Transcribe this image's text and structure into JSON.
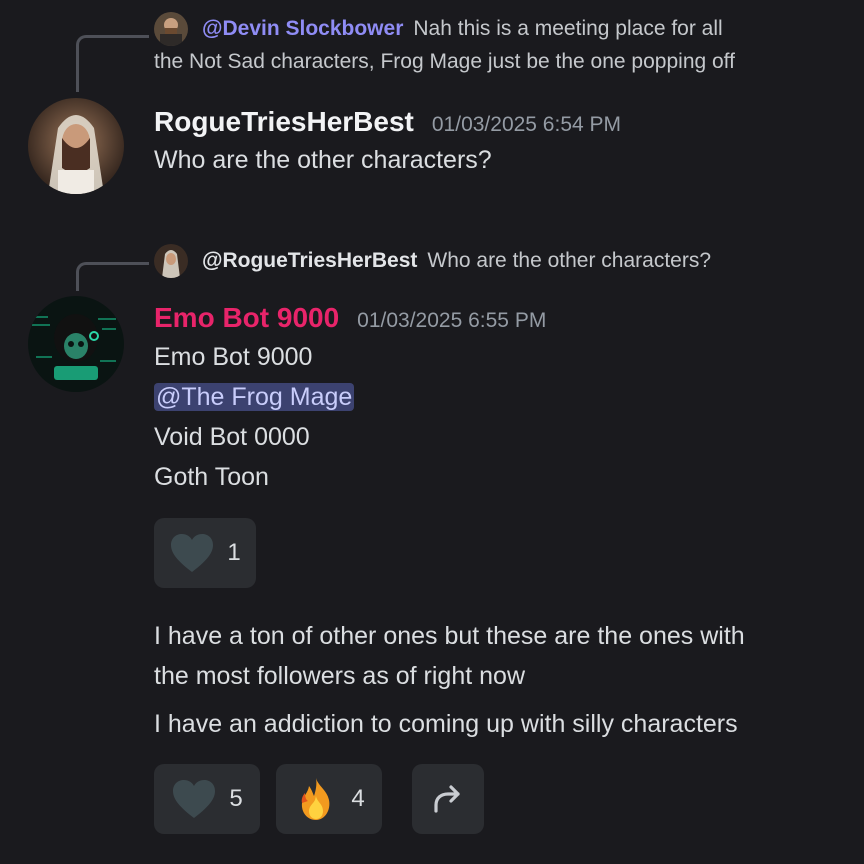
{
  "reply1": {
    "mention": "@Devin Slockbower",
    "text_line1": "Nah this is a meeting place for all",
    "text_line2": "the Not Sad characters, Frog Mage just be the one popping off"
  },
  "message1": {
    "username": "RogueTriesHerBest",
    "timestamp": "01/03/2025 6:54 PM",
    "content": "Who are the other characters?"
  },
  "reply2": {
    "mention": "@RogueTriesHerBest",
    "text": "Who are the other characters?"
  },
  "message2": {
    "username": "Emo Bot 9000",
    "timestamp": "01/03/2025 6:55 PM",
    "lines": [
      "Emo Bot 9000",
      "@The Frog Mage",
      "Void Bot 0000",
      "Goth Toon"
    ],
    "reactions": [
      {
        "icon": "heart-icon",
        "count": "1"
      }
    ]
  },
  "message3": {
    "line1": "I have a ton of other ones but these are the ones with",
    "line2": "the most followers as of right now",
    "line3": "I have an addiction to coming up with silly characters",
    "reactions": [
      {
        "icon": "heart-icon",
        "count": "5"
      },
      {
        "icon": "fire-icon",
        "count": "4"
      }
    ],
    "action_icon": "share-arrow-icon"
  },
  "colors": {
    "background": "#1a1a1e",
    "mention_blue": "#8f8cf5",
    "emo_bot_name": "#e8246a",
    "mention_pill": "#3c4270",
    "reaction_bg": "#2b2d31"
  }
}
